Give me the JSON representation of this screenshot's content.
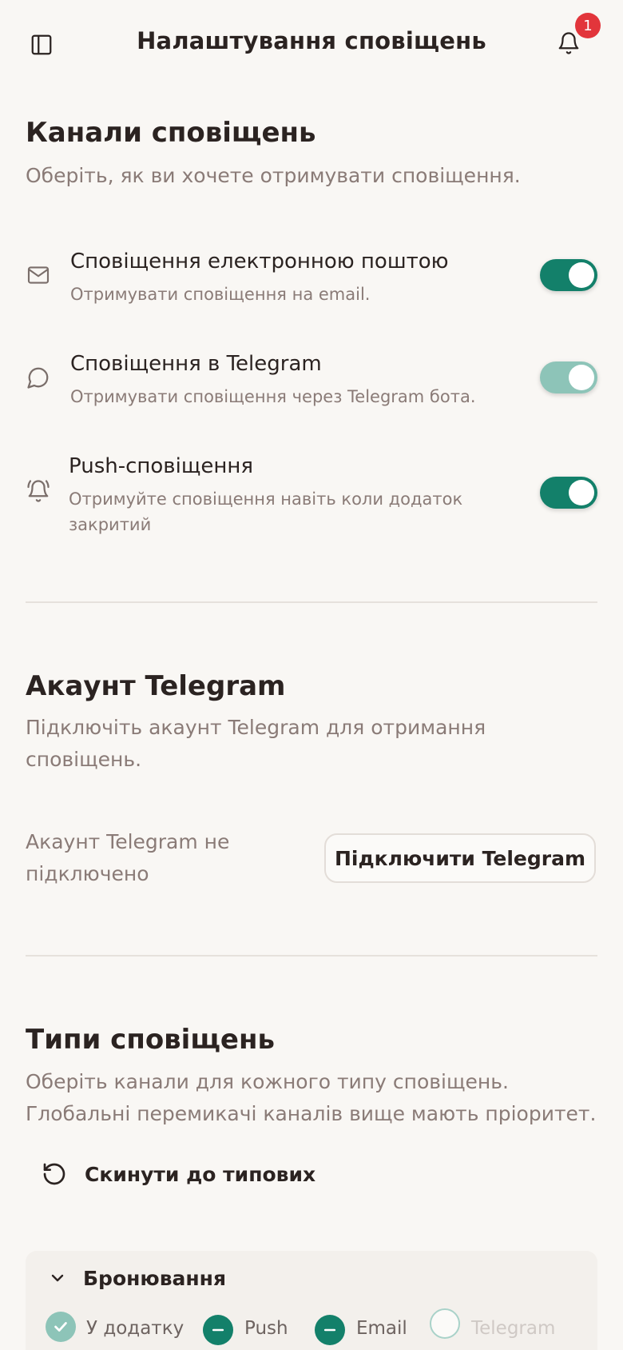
{
  "header": {
    "title": "Налаштування сповіщень",
    "notification_count": "1"
  },
  "channels": {
    "title": "Канали сповіщень",
    "subtitle": "Оберіть, як ви хочете отримувати сповіщення.",
    "items": [
      {
        "icon": "mail-icon",
        "title": "Сповіщення електронною поштою",
        "subtitle": "Отримувати сповіщення на email.",
        "enabled": true
      },
      {
        "icon": "chat-bubble-icon",
        "title": "Сповіщення в Telegram",
        "subtitle": "Отримувати сповіщення через Telegram бота.",
        "enabled": true,
        "disabled_look": true
      },
      {
        "icon": "bell-ringing-icon",
        "title": "Push-сповіщення",
        "subtitle_line1": "Отримуйте сповіщення навіть коли додаток",
        "subtitle_line2": "закритий",
        "enabled": true
      }
    ]
  },
  "telegram_account": {
    "title": "Акаунт Telegram",
    "subtitle_line1": "Підключіть акаунт Telegram для отримання",
    "subtitle_line2": "сповіщень.",
    "status_line1": "Акаунт Telegram не",
    "status_line2": "підключено",
    "connect_label": "Підключити Telegram"
  },
  "types": {
    "title": "Типи сповіщень",
    "subtitle_line1": "Оберіть канали для кожного типу сповіщень.",
    "subtitle_line2": "Глобальні перемикачі каналів вище мають пріоритет.",
    "reset_label": "Скинути до типових",
    "groups": [
      {
        "name": "Бронювання",
        "channels": [
          {
            "label": "У додатку",
            "state": "checked"
          },
          {
            "label": "Push",
            "state": "indeterminate"
          },
          {
            "label": "Email",
            "state": "indeterminate"
          },
          {
            "label": "Telegram",
            "state": "unchecked-disabled"
          }
        ]
      }
    ]
  },
  "colors": {
    "accent": "#13806a",
    "accent_light": "#8dc4b8",
    "badge": "#e2353b",
    "background": "#f9f7f4"
  }
}
